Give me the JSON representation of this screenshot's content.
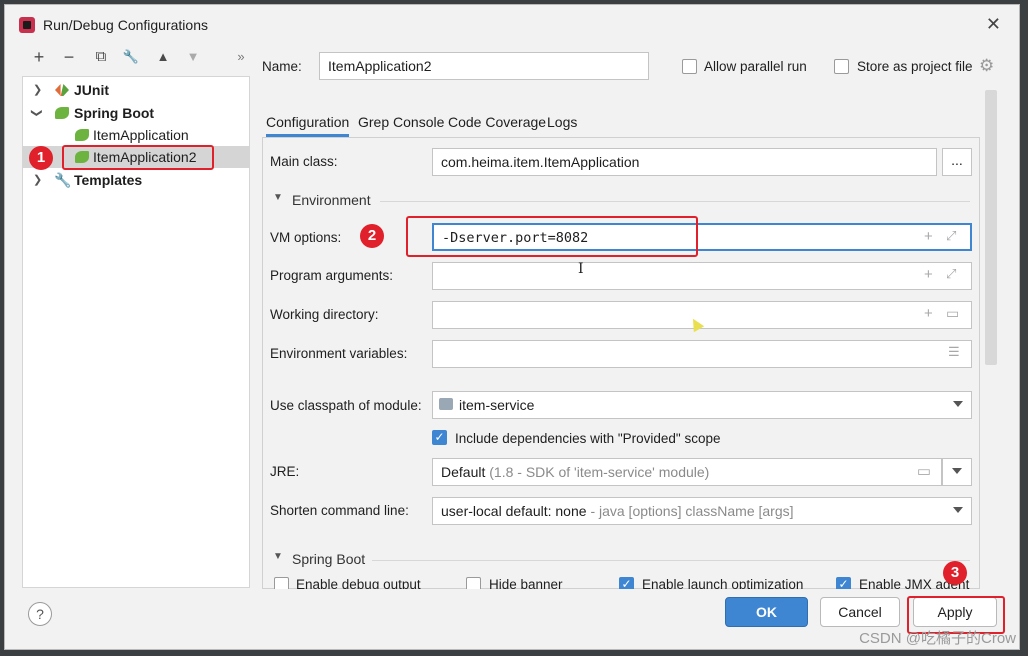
{
  "window": {
    "title": "Run/Debug Configurations",
    "close": "✕"
  },
  "toolbar": {
    "add": "+",
    "remove": "−",
    "copy": "⧉",
    "edit": "🔧",
    "up": "▲",
    "down": "▼",
    "more": "»"
  },
  "tree": [
    {
      "label": "JUnit",
      "expanded": false,
      "bold": true
    },
    {
      "label": "Spring Boot",
      "expanded": true,
      "bold": true
    },
    {
      "label": "ItemApplication",
      "child": true
    },
    {
      "label": "ItemApplication2",
      "child": true,
      "selected": true
    },
    {
      "label": "Templates",
      "expanded": false,
      "bold": true
    }
  ],
  "badges": {
    "one": "1",
    "two": "2",
    "three": "3"
  },
  "name": {
    "label": "Name:",
    "value": "ItemApplication2"
  },
  "options": {
    "allow_parallel": "Allow parallel run",
    "store_project": "Store as project file"
  },
  "tabs": [
    "Configuration",
    "Grep Console",
    "Code Coverage",
    "Logs"
  ],
  "form": {
    "main_class_label": "Main class:",
    "main_class_value": "com.heima.item.ItemApplication",
    "browse": "...",
    "environment_section": "Environment",
    "vm_options_label": "VM options:",
    "vm_options_value": "-Dserver.port=8082",
    "program_args_label": "Program arguments:",
    "working_dir_label": "Working directory:",
    "env_vars_label": "Environment variables:",
    "classpath_label": "Use classpath of module:",
    "classpath_value": "item-service",
    "include_deps": "Include dependencies with \"Provided\" scope",
    "jre_label": "JRE:",
    "jre_value": "Default",
    "jre_hint": "(1.8 - SDK of 'item-service' module)",
    "shorten_label": "Shorten command line:",
    "shorten_value": "user-local default: none",
    "shorten_hint": "- java [options] className [args]",
    "spring_boot_section": "Spring Boot",
    "enable_debug": "Enable debug output",
    "hide_banner": "Hide banner",
    "launch_opt": "Enable launch optimization",
    "jmx_agent": "Enable JMX agent"
  },
  "footer": {
    "help": "?",
    "ok": "OK",
    "cancel": "Cancel",
    "apply": "Apply"
  },
  "watermark": "CSDN @吃橘子的Crow",
  "colors": {
    "accent": "#3e86d1",
    "annotation_red": "#e0202a",
    "spring_green": "#6db33f"
  }
}
